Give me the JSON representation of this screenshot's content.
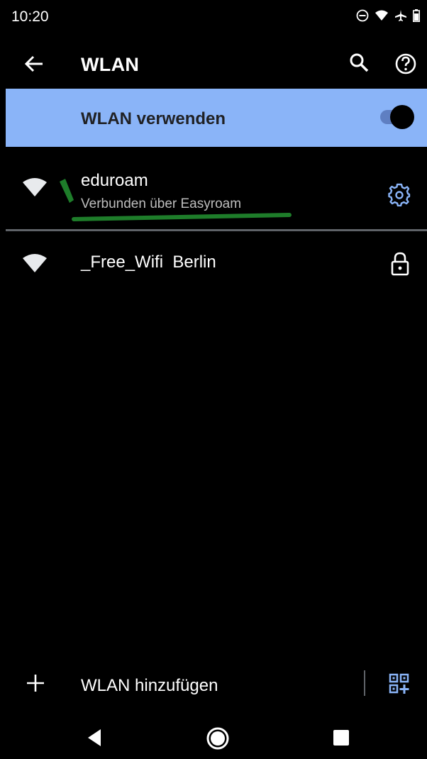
{
  "status_bar": {
    "time": "10:20",
    "icons": [
      "dnd-icon",
      "wifi-signal-icon",
      "airplane-icon",
      "battery-icon"
    ]
  },
  "app_bar": {
    "title": "WLAN",
    "icons": [
      "back-arrow-icon",
      "search-icon",
      "help-icon"
    ]
  },
  "master_toggle": {
    "label": "WLAN verwenden",
    "enabled": true,
    "accent": "#8ab4f8"
  },
  "networks": [
    {
      "name": "eduroam",
      "status": "Verbunden über Easyroam",
      "action_icon": "gear-icon",
      "connected": true
    },
    {
      "name": "_Free_Wifi  Berlin",
      "status": "",
      "action_icon": "lock-icon",
      "connected": false
    }
  ],
  "add_network": {
    "label": "WLAN hinzufügen",
    "icons": [
      "plus-icon",
      "qr-code-scan-icon"
    ]
  },
  "nav_bar": {
    "icons": [
      "nav-back-icon",
      "nav-home-icon",
      "nav-recents-icon"
    ]
  },
  "colors": {
    "background": "#000000",
    "accent": "#8ab4f8",
    "gear": "#8ab4f8",
    "annotation": "#1e7d2a"
  }
}
